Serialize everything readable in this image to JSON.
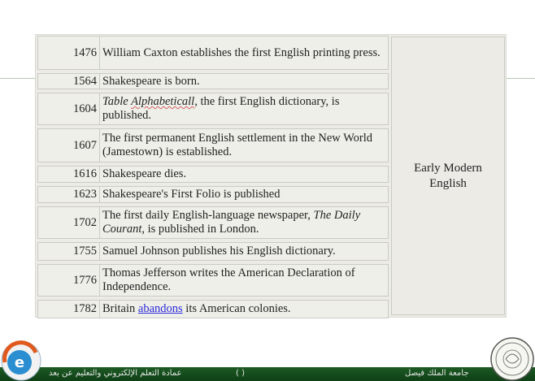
{
  "period_label": "Early Modern English",
  "events": [
    {
      "year": "1476",
      "parts": [
        {
          "text": "William Caxton establishes the first English printing press."
        }
      ]
    },
    {
      "year": "1564",
      "parts": [
        {
          "text": "Shakespeare is born."
        }
      ]
    },
    {
      "year": "1604",
      "parts": [
        {
          "text": "Table ",
          "style": "italic"
        },
        {
          "text": "Alphabeticall",
          "style": "italic-squiggle"
        },
        {
          "text": ",  the first English dictionary, is published."
        }
      ]
    },
    {
      "year": "1607",
      "parts": [
        {
          "text": "The first permanent English settlement in the New World (Jamestown) is established."
        }
      ]
    },
    {
      "year": "1616",
      "parts": [
        {
          "text": "Shakespeare dies."
        }
      ]
    },
    {
      "year": "1623",
      "parts": [
        {
          "text": "Shakespeare's First Folio is published"
        }
      ]
    },
    {
      "year": "1702",
      "parts": [
        {
          "text": "The first daily English-language newspaper, "
        },
        {
          "text": "The Daily Courant",
          "style": "italic"
        },
        {
          "text": ", is published in London."
        }
      ]
    },
    {
      "year": "1755",
      "parts": [
        {
          "text": "Samuel Johnson publishes his English dictionary."
        }
      ]
    },
    {
      "year": "1776",
      "parts": [
        {
          "text": "Thomas Jefferson writes the American Declaration of Independence."
        }
      ]
    },
    {
      "year": "1782",
      "parts": [
        {
          "text": "Britain "
        },
        {
          "text": "abandons",
          "style": "link"
        },
        {
          "text": " its American colonies."
        }
      ]
    }
  ],
  "footer": {
    "left_text": "عمادة التعلم الإلكتروني والتعليم عن بعد",
    "mid_text": "(           )",
    "right_text": "جامعة الملك فيصل"
  },
  "logos": {
    "left": "e-learning-logo",
    "right": "university-seal"
  },
  "colors": {
    "table_bg": "#efefe9",
    "link": "#2a2adb",
    "footer_bg": "#1c5a24",
    "divider": "#b7ccb0"
  }
}
